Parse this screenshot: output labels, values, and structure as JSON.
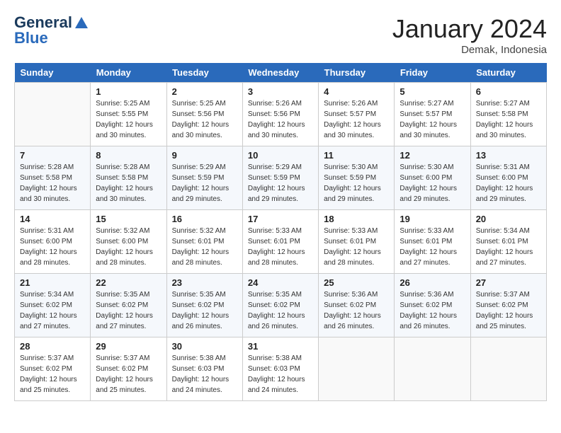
{
  "header": {
    "logo_line1": "General",
    "logo_line2": "Blue",
    "month": "January 2024",
    "location": "Demak, Indonesia"
  },
  "days_of_week": [
    "Sunday",
    "Monday",
    "Tuesday",
    "Wednesday",
    "Thursday",
    "Friday",
    "Saturday"
  ],
  "weeks": [
    [
      {
        "day": "",
        "info": ""
      },
      {
        "day": "1",
        "info": "Sunrise: 5:25 AM\nSunset: 5:55 PM\nDaylight: 12 hours\nand 30 minutes."
      },
      {
        "day": "2",
        "info": "Sunrise: 5:25 AM\nSunset: 5:56 PM\nDaylight: 12 hours\nand 30 minutes."
      },
      {
        "day": "3",
        "info": "Sunrise: 5:26 AM\nSunset: 5:56 PM\nDaylight: 12 hours\nand 30 minutes."
      },
      {
        "day": "4",
        "info": "Sunrise: 5:26 AM\nSunset: 5:57 PM\nDaylight: 12 hours\nand 30 minutes."
      },
      {
        "day": "5",
        "info": "Sunrise: 5:27 AM\nSunset: 5:57 PM\nDaylight: 12 hours\nand 30 minutes."
      },
      {
        "day": "6",
        "info": "Sunrise: 5:27 AM\nSunset: 5:58 PM\nDaylight: 12 hours\nand 30 minutes."
      }
    ],
    [
      {
        "day": "7",
        "info": "Sunrise: 5:28 AM\nSunset: 5:58 PM\nDaylight: 12 hours\nand 30 minutes."
      },
      {
        "day": "8",
        "info": "Sunrise: 5:28 AM\nSunset: 5:58 PM\nDaylight: 12 hours\nand 30 minutes."
      },
      {
        "day": "9",
        "info": "Sunrise: 5:29 AM\nSunset: 5:59 PM\nDaylight: 12 hours\nand 29 minutes."
      },
      {
        "day": "10",
        "info": "Sunrise: 5:29 AM\nSunset: 5:59 PM\nDaylight: 12 hours\nand 29 minutes."
      },
      {
        "day": "11",
        "info": "Sunrise: 5:30 AM\nSunset: 5:59 PM\nDaylight: 12 hours\nand 29 minutes."
      },
      {
        "day": "12",
        "info": "Sunrise: 5:30 AM\nSunset: 6:00 PM\nDaylight: 12 hours\nand 29 minutes."
      },
      {
        "day": "13",
        "info": "Sunrise: 5:31 AM\nSunset: 6:00 PM\nDaylight: 12 hours\nand 29 minutes."
      }
    ],
    [
      {
        "day": "14",
        "info": "Sunrise: 5:31 AM\nSunset: 6:00 PM\nDaylight: 12 hours\nand 28 minutes."
      },
      {
        "day": "15",
        "info": "Sunrise: 5:32 AM\nSunset: 6:00 PM\nDaylight: 12 hours\nand 28 minutes."
      },
      {
        "day": "16",
        "info": "Sunrise: 5:32 AM\nSunset: 6:01 PM\nDaylight: 12 hours\nand 28 minutes."
      },
      {
        "day": "17",
        "info": "Sunrise: 5:33 AM\nSunset: 6:01 PM\nDaylight: 12 hours\nand 28 minutes."
      },
      {
        "day": "18",
        "info": "Sunrise: 5:33 AM\nSunset: 6:01 PM\nDaylight: 12 hours\nand 28 minutes."
      },
      {
        "day": "19",
        "info": "Sunrise: 5:33 AM\nSunset: 6:01 PM\nDaylight: 12 hours\nand 27 minutes."
      },
      {
        "day": "20",
        "info": "Sunrise: 5:34 AM\nSunset: 6:01 PM\nDaylight: 12 hours\nand 27 minutes."
      }
    ],
    [
      {
        "day": "21",
        "info": "Sunrise: 5:34 AM\nSunset: 6:02 PM\nDaylight: 12 hours\nand 27 minutes."
      },
      {
        "day": "22",
        "info": "Sunrise: 5:35 AM\nSunset: 6:02 PM\nDaylight: 12 hours\nand 27 minutes."
      },
      {
        "day": "23",
        "info": "Sunrise: 5:35 AM\nSunset: 6:02 PM\nDaylight: 12 hours\nand 26 minutes."
      },
      {
        "day": "24",
        "info": "Sunrise: 5:35 AM\nSunset: 6:02 PM\nDaylight: 12 hours\nand 26 minutes."
      },
      {
        "day": "25",
        "info": "Sunrise: 5:36 AM\nSunset: 6:02 PM\nDaylight: 12 hours\nand 26 minutes."
      },
      {
        "day": "26",
        "info": "Sunrise: 5:36 AM\nSunset: 6:02 PM\nDaylight: 12 hours\nand 26 minutes."
      },
      {
        "day": "27",
        "info": "Sunrise: 5:37 AM\nSunset: 6:02 PM\nDaylight: 12 hours\nand 25 minutes."
      }
    ],
    [
      {
        "day": "28",
        "info": "Sunrise: 5:37 AM\nSunset: 6:02 PM\nDaylight: 12 hours\nand 25 minutes."
      },
      {
        "day": "29",
        "info": "Sunrise: 5:37 AM\nSunset: 6:02 PM\nDaylight: 12 hours\nand 25 minutes."
      },
      {
        "day": "30",
        "info": "Sunrise: 5:38 AM\nSunset: 6:03 PM\nDaylight: 12 hours\nand 24 minutes."
      },
      {
        "day": "31",
        "info": "Sunrise: 5:38 AM\nSunset: 6:03 PM\nDaylight: 12 hours\nand 24 minutes."
      },
      {
        "day": "",
        "info": ""
      },
      {
        "day": "",
        "info": ""
      },
      {
        "day": "",
        "info": ""
      }
    ]
  ]
}
